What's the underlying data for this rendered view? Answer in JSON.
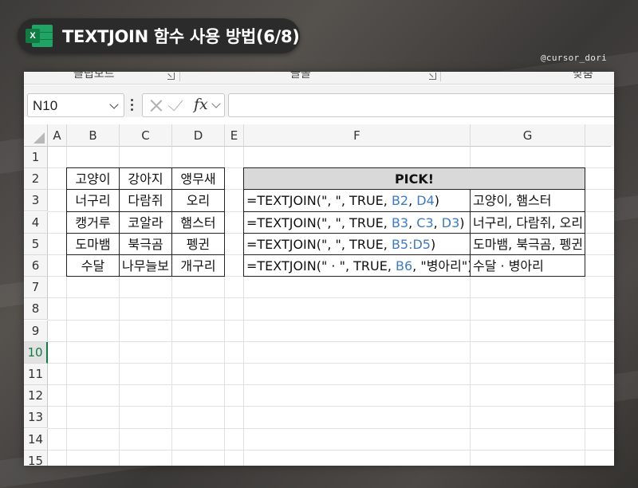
{
  "title": "TEXTJOIN 함수 사용 방법(6/8)",
  "watermark": "@cursor_dori",
  "ribbon": {
    "groups": [
      "클립보드",
      "글꼴",
      "맞춤"
    ]
  },
  "formula_bar": {
    "name_box": "N10",
    "fx_label": "fx",
    "formula": ""
  },
  "columns": [
    "A",
    "B",
    "C",
    "D",
    "E",
    "F",
    "G"
  ],
  "rows": [
    "1",
    "2",
    "3",
    "4",
    "5",
    "6",
    "7",
    "8",
    "9",
    "10",
    "11",
    "12",
    "13",
    "14",
    "15"
  ],
  "active_row": "10",
  "animals": [
    [
      "고양이",
      "강아지",
      "앵무새"
    ],
    [
      "너구리",
      "다람쥐",
      "오리"
    ],
    [
      "캥거루",
      "코알라",
      "햄스터"
    ],
    [
      "도마뱀",
      "북극곰",
      "펭귄"
    ],
    [
      "수달",
      "나무늘보",
      "개구리"
    ]
  ],
  "pick_header": "PICK!",
  "formulas": [
    [
      {
        "t": "=TEXTJOIN(\", \", TRUE, "
      },
      {
        "t": "B2",
        "ref": true
      },
      {
        "t": ", "
      },
      {
        "t": "D4",
        "ref": true
      },
      {
        "t": ")"
      }
    ],
    [
      {
        "t": "=TEXTJOIN(\", \", TRUE, "
      },
      {
        "t": "B3",
        "ref": true
      },
      {
        "t": ", "
      },
      {
        "t": "C3",
        "ref": true
      },
      {
        "t": ", "
      },
      {
        "t": "D3",
        "ref": true
      },
      {
        "t": ")"
      }
    ],
    [
      {
        "t": "=TEXTJOIN(\", \", TRUE, "
      },
      {
        "t": "B5:D5",
        "ref": true
      },
      {
        "t": ")"
      }
    ],
    [
      {
        "t": "=TEXTJOIN(\" · \", TRUE, "
      },
      {
        "t": "B6",
        "ref": true
      },
      {
        "t": ", \"병아리\")"
      }
    ]
  ],
  "results": [
    "고양이, 햄스터",
    "너구리, 다람쥐, 오리",
    "도마뱀, 북극곰, 펭귄",
    "수달 · 병아리"
  ],
  "colors": {
    "excel_green": "#107c41",
    "reference_blue": "#3e7bc4",
    "header_gray": "#d9d9d9"
  }
}
